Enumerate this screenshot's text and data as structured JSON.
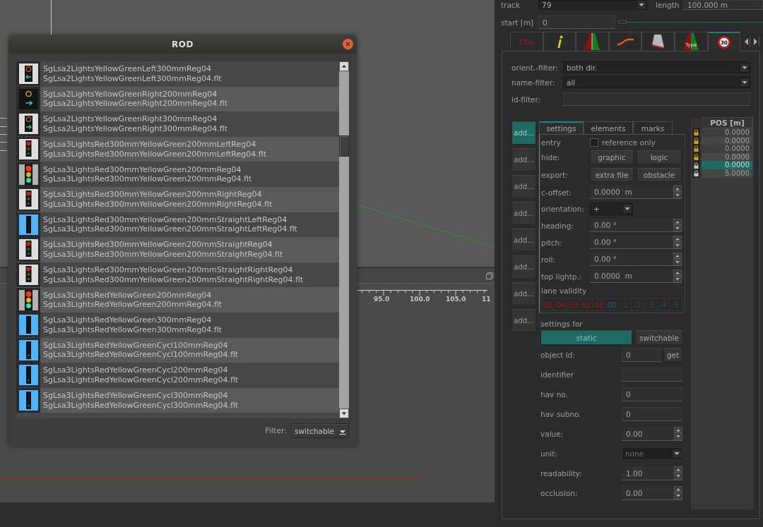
{
  "timeline": {
    "ruler_labels": [
      "95.0",
      "100.0",
      "105.0",
      "11"
    ]
  },
  "dialog": {
    "title": "ROD",
    "items": [
      {
        "kind": "left",
        "name": "SgLsa2LightsYellowGreenLeft300mmReg04",
        "file": "SgLsa2LightsYellowGreenLeft300mmReg04.flt",
        "selected": false
      },
      {
        "kind": "rightdark",
        "name": "SgLsa2LightsYellowGreenRight200mmReg04",
        "file": "SgLsa2LightsYellowGreenRight200mmReg04.flt",
        "selected": false
      },
      {
        "kind": "right",
        "name": "SgLsa2LightsYellowGreenRight300mmReg04",
        "file": "SgLsa2LightsYellowGreenRight300mmReg04.flt",
        "selected": false
      },
      {
        "kind": "small",
        "name": "SgLsa3LightsRed300mmYellowGreen200mmLeftReg04",
        "file": "SgLsa3LightsRed300mmYellowGreen200mmLeftReg04.flt",
        "selected": false
      },
      {
        "kind": "lamps",
        "name": "SgLsa3LightsRed300mmYellowGreen200mmReg04",
        "file": "SgLsa3LightsRed300mmYellowGreen200mmReg04.flt",
        "selected": false
      },
      {
        "kind": "small",
        "name": "SgLsa3LightsRed300mmYellowGreen200mmRightReg04",
        "file": "SgLsa3LightsRed300mmYellowGreen200mmRightReg04.flt",
        "selected": false
      },
      {
        "kind": "bar",
        "name": "SgLsa3LightsRed300mmYellowGreen200mmStraightLeftReg04",
        "file": "SgLsa3LightsRed300mmYellowGreen200mmStraightLeftReg04.flt",
        "selected": false
      },
      {
        "kind": "small",
        "name": "SgLsa3LightsRed300mmYellowGreen200mmStraightReg04",
        "file": "SgLsa3LightsRed300mmYellowGreen200mmStraightReg04.flt",
        "selected": false
      },
      {
        "kind": "small",
        "name": "SgLsa3LightsRed300mmYellowGreen200mmStraightRightReg04",
        "file": "SgLsa3LightsRed300mmYellowGreen200mmStraightRightReg04.flt",
        "selected": false
      },
      {
        "kind": "lamps",
        "name": "SgLsa3LightsRedYellowGreen200mmReg04",
        "file": "SgLsa3LightsRedYellowGreen200mmReg04.flt",
        "selected": false
      },
      {
        "kind": "bar",
        "name": "SgLsa3LightsRedYellowGreen300mmReg04",
        "file": "SgLsa3LightsRedYellowGreen300mmReg04.flt",
        "selected": false
      },
      {
        "kind": "bardot",
        "name": "SgLsa3LightsRedYellowGreenCycl100mmReg04",
        "file": "SgLsa3LightsRedYellowGreenCycl100mmReg04.flt",
        "selected": false
      },
      {
        "kind": "bardot",
        "name": "SgLsa3LightsRedYellowGreenCycl200mmReg04",
        "file": "SgLsa3LightsRedYellowGreenCycl200mmReg04.flt",
        "selected": false
      },
      {
        "kind": "bardot",
        "name": "SgLsa3LightsRedYellowGreenCycl300mmReg04",
        "file": "SgLsa3LightsRedYellowGreenCycl300mmReg04.flt",
        "selected": false
      }
    ],
    "filter": {
      "label": "Filter:",
      "value": "switchable"
    }
  },
  "panel": {
    "track": {
      "label": "track",
      "value": "79"
    },
    "length": {
      "label": "length",
      "value": "100.000 m"
    },
    "start": {
      "label": "start [m]",
      "value": "0",
      "level": 0
    },
    "tabs": [
      {
        "kind": "crg",
        "label": "CRG",
        "selected": false
      },
      {
        "kind": "info",
        "selected": false
      },
      {
        "kind": "road",
        "selected": false
      },
      {
        "kind": "curve",
        "selected": false
      },
      {
        "kind": "profile",
        "selected": false
      },
      {
        "kind": "roadtype",
        "label": "Type",
        "selected": false
      },
      {
        "kind": "sign",
        "label": "30",
        "selected": true
      }
    ],
    "filters": [
      {
        "label": "orient.-filter:",
        "kind": "combo",
        "value": "both dir."
      },
      {
        "label": "name-filter:",
        "kind": "combo",
        "value": "all"
      },
      {
        "label": "id-filter:",
        "kind": "field"
      }
    ],
    "add_buttons": [
      {
        "label": "add...",
        "selected": true
      },
      {
        "label": "add...",
        "selected": false
      },
      {
        "label": "add...",
        "selected": false
      },
      {
        "label": "add...",
        "selected": false
      },
      {
        "label": "add...",
        "selected": false
      },
      {
        "label": "add...",
        "selected": false
      },
      {
        "label": "add...",
        "selected": false
      },
      {
        "label": "add...",
        "selected": false
      }
    ],
    "sub_tabs": [
      {
        "label": "settings",
        "selected": true
      },
      {
        "label": "elements",
        "selected": false
      },
      {
        "label": "marks",
        "selected": false
      }
    ],
    "entry": {
      "label": "entry",
      "option": "reference only",
      "checked": false
    },
    "hide": {
      "label": "hide:",
      "buttons": [
        "graphic",
        "logic"
      ]
    },
    "export": {
      "label": "export:",
      "buttons": [
        "extra file",
        "obstacle"
      ]
    },
    "fields": [
      {
        "label": "c-offset:",
        "kind": "spin",
        "value": "0.0000  m"
      },
      {
        "label": "orientation:",
        "kind": "combo",
        "value": "+"
      },
      {
        "label": "heading:",
        "kind": "spin",
        "value": "0.00 °"
      },
      {
        "label": "pitch:",
        "kind": "spin",
        "value": "0.00 °"
      },
      {
        "label": "roll:",
        "kind": "spin",
        "value": "0.00 °"
      },
      {
        "label": "top lightp.:",
        "kind": "spin",
        "value": "0.0000  m"
      }
    ],
    "lane_validity": {
      "label": "lane validity",
      "lanes": [
        {
          "text": "05",
          "color": "#a81414"
        },
        {
          "text": "04",
          "color": "#a81414"
        },
        {
          "text": "03",
          "color": "#a81414"
        },
        {
          "text": "02",
          "color": "#a81414"
        },
        {
          "text": "01",
          "color": "#a81414"
        },
        {
          "text": "00",
          "color": "#0e7272"
        },
        {
          "text": "-1",
          "color": "#1b5c1b"
        },
        {
          "text": "-2",
          "color": "#1b5c1b"
        },
        {
          "text": "-3",
          "color": "#1b5c1b"
        },
        {
          "text": "-4",
          "color": "#1b5c1b"
        },
        {
          "text": "-5",
          "color": "#1b5c1b"
        }
      ]
    },
    "settings_for": {
      "label": "settings for",
      "options": [
        {
          "label": "static",
          "selected": true
        },
        {
          "label": "switchable",
          "selected": false
        }
      ]
    },
    "properties": [
      {
        "label": "object id:",
        "kind": "field",
        "value": "0",
        "button": "get"
      },
      {
        "label": "identifier",
        "kind": "field"
      },
      {
        "label": "hav no.",
        "kind": "field",
        "value": "0"
      },
      {
        "label": "hav subno.",
        "kind": "field",
        "value": "0"
      },
      {
        "label": "value:",
        "kind": "spin",
        "value": "0.00"
      },
      {
        "label": "unit:",
        "kind": "combo",
        "value": "none"
      },
      {
        "label": "readability:",
        "kind": "spin",
        "value": "1.00"
      },
      {
        "label": "occlusion:",
        "kind": "spin",
        "value": "0.00"
      }
    ],
    "positions": {
      "header": "POS [m]",
      "rows": [
        {
          "locked": true,
          "value": "0.0000",
          "selected": false
        },
        {
          "locked": true,
          "value": "0.0000",
          "selected": false
        },
        {
          "locked": true,
          "value": "0.0000",
          "selected": false
        },
        {
          "locked": true,
          "value": "0.0000",
          "selected": false
        },
        {
          "locked": false,
          "value": "0.0000",
          "selected": true
        },
        {
          "locked": false,
          "value": "5.0000",
          "selected": false
        }
      ]
    }
  }
}
